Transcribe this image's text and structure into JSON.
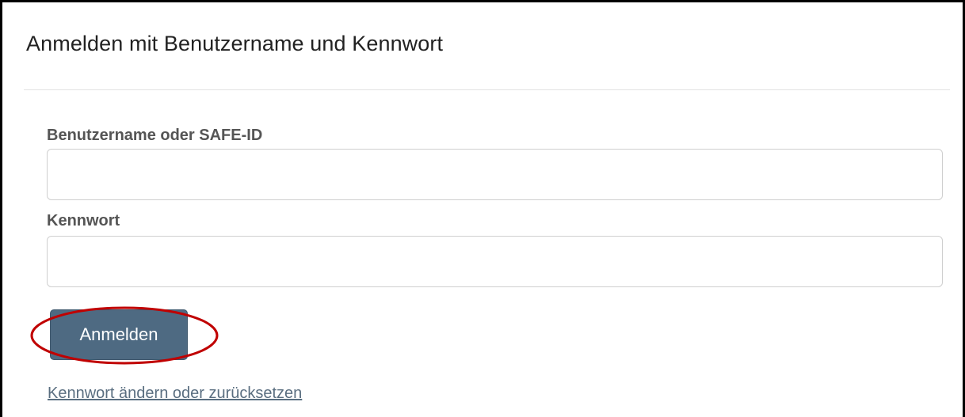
{
  "panel": {
    "title": "Anmelden mit Benutzername und Kennwort"
  },
  "form": {
    "username": {
      "label": "Benutzername oder SAFE-ID",
      "value": "",
      "placeholder": ""
    },
    "password": {
      "label": "Kennwort",
      "value": "",
      "placeholder": ""
    },
    "submit_label": "Anmelden",
    "reset_link": "Kennwort ändern oder zurücksetzen"
  },
  "colors": {
    "button_bg": "#4e6a82",
    "highlight_ring": "#c00000",
    "link": "#5a6e80"
  }
}
